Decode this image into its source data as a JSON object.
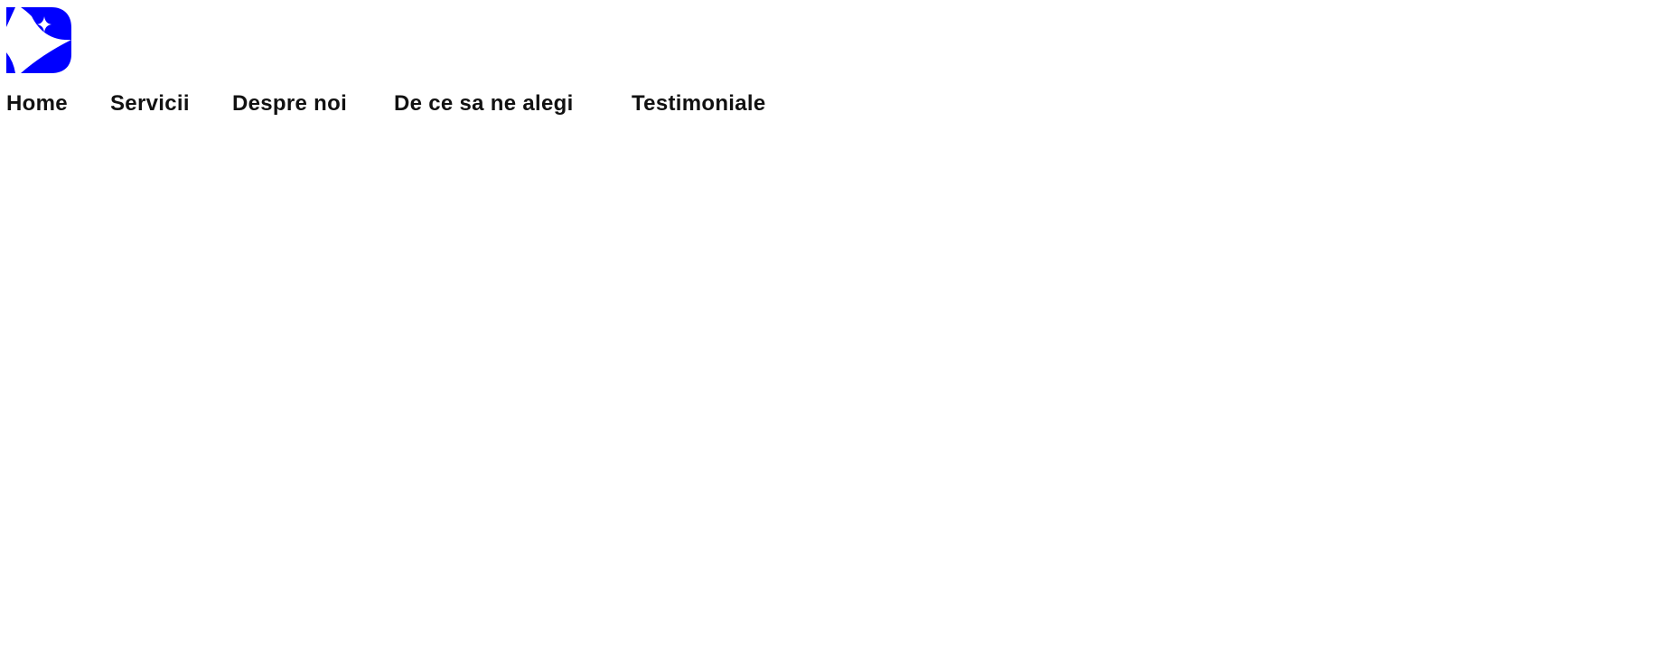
{
  "header": {
    "logo": {
      "icon": "sparkle-star-logo-icon",
      "color": "#0000ff"
    },
    "nav": [
      {
        "label": "Home"
      },
      {
        "label": "Servicii"
      },
      {
        "label": "Despre noi"
      },
      {
        "label": "De ce sa ne alegi"
      },
      {
        "label": "Testimoniale"
      }
    ]
  }
}
